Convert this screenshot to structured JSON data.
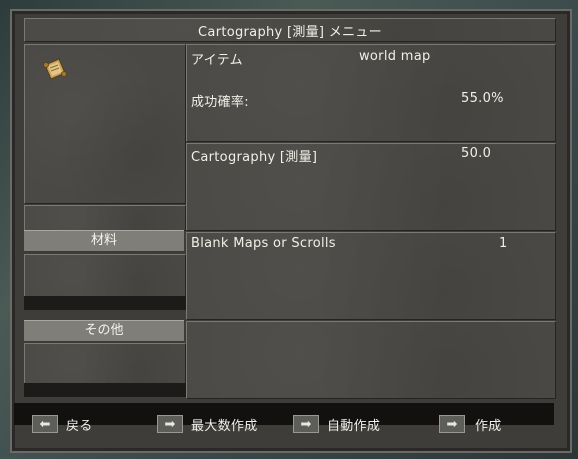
{
  "window": {
    "title": "Cartography [測量] メニュー"
  },
  "item": {
    "label": "アイテム",
    "value": "world map",
    "success_label": "成功確率:",
    "success_value": "55.0%",
    "icon": "map-scroll-icon"
  },
  "skill": {
    "name": "Cartography [測量]",
    "value": "50.0"
  },
  "materials": {
    "header": "材料",
    "rows": [
      {
        "name": "Blank Maps or Scrolls",
        "count": "1"
      }
    ]
  },
  "other": {
    "header": "その他"
  },
  "buttons": {
    "back": "戻る",
    "make_max": "最大数作成",
    "auto_make": "自動作成",
    "make": "作成"
  },
  "colors": {
    "panel": "#4a4945",
    "frame": "#3e3d3a",
    "header_bar": "#807e78",
    "text": "#f0f0e8"
  }
}
